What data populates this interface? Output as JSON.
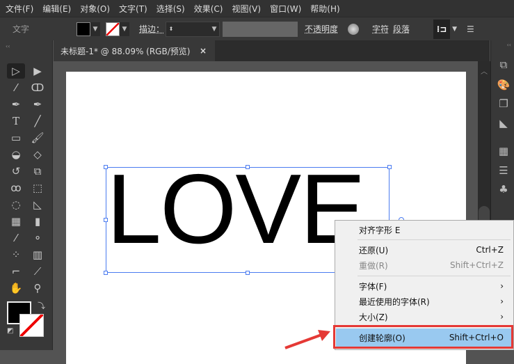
{
  "menubar": [
    "文件(F)",
    "编辑(E)",
    "对象(O)",
    "文字(T)",
    "选择(S)",
    "效果(C)",
    "视图(V)",
    "窗口(W)",
    "帮助(H)"
  ],
  "options": {
    "tool_label": "文字",
    "stroke_label": "描边：",
    "opacity_label": "不透明度",
    "char_label": "字符",
    "para_label": "段落"
  },
  "tab": {
    "title": "未标题-1* @ 88.09% (RGB/预览)",
    "close": "×"
  },
  "artboard": {
    "text": "LOVE"
  },
  "context_menu": {
    "items": [
      {
        "label": "对齐字形 E",
        "shortcut": ""
      },
      {
        "label": "还原(U)",
        "shortcut": "Ctrl+Z"
      },
      {
        "label": "重做(R)",
        "shortcut": "Shift+Ctrl+Z"
      },
      {
        "label": "字体(F)",
        "shortcut": "›"
      },
      {
        "label": "最近使用的字体(R)",
        "shortcut": "›"
      },
      {
        "label": "大小(Z)",
        "shortcut": "›"
      },
      {
        "label": "创建轮廓(O)",
        "shortcut": "Shift+Ctrl+O"
      }
    ]
  },
  "colors": {
    "selection": "#4a7bf0",
    "highlight": "#99c9f0",
    "annotation": "#e53935"
  }
}
